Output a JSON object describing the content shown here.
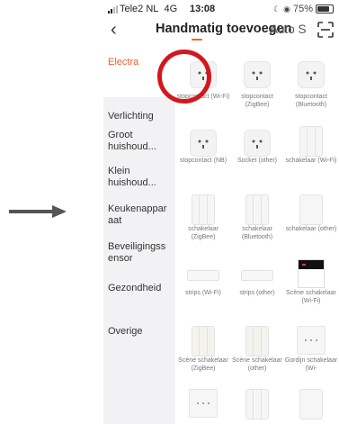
{
  "statusbar": {
    "carrier": "Tele2 NL",
    "network": "4G",
    "time": "13:08",
    "battery": "75%",
    "battery_level": 0.75
  },
  "header": {
    "title": "Handmatig toevoegen",
    "tab_auto": "Auto S",
    "back_icon": "chevron-left-icon",
    "scan_icon": "scan-icon"
  },
  "sidebar": {
    "items": [
      {
        "label": "Electra",
        "active": true
      },
      {
        "label": "Verlichting"
      },
      {
        "label": "Groot huishoud..."
      },
      {
        "label": "Klein huishoud..."
      },
      {
        "label": "Keukenapparaat"
      },
      {
        "label": "Beveiligingssensor"
      },
      {
        "label": "Gezondheid"
      },
      {
        "label": "Overige"
      }
    ]
  },
  "devices": [
    {
      "label": "stopcontact (Wi-Fi)",
      "icon": "socket"
    },
    {
      "label": "stopcontact (ZigBee)",
      "icon": "socket"
    },
    {
      "label": "stopcontact (Bluetooth)",
      "icon": "socket"
    },
    {
      "label": "stopcontact (NB)",
      "icon": "socket"
    },
    {
      "label": "Socket (other)",
      "icon": "socket"
    },
    {
      "label": "schakelaar (Wi-Fi)",
      "icon": "switch"
    },
    {
      "label": "schakelaar (ZigBee)",
      "icon": "switch"
    },
    {
      "label": "schakelaar (Bluetooth)",
      "icon": "switch"
    },
    {
      "label": "schakelaar (other)",
      "icon": "switch"
    },
    {
      "label": "strips (Wi-Fi)",
      "icon": "strip"
    },
    {
      "label": "strips (other)",
      "icon": "strip"
    },
    {
      "label": "Scène schakelaar (Wi-Fi)",
      "icon": "scene"
    },
    {
      "label": "Scène schakelaar (ZigBee)",
      "icon": "switch"
    },
    {
      "label": "Scène schakelaar (other)",
      "icon": "switch"
    },
    {
      "label": "Gordijn schakelaar (Wi-",
      "icon": "curtain"
    }
  ],
  "colors": {
    "accent": "#ff5a28",
    "annotation": "#d4171f",
    "arrow": "#555555"
  }
}
